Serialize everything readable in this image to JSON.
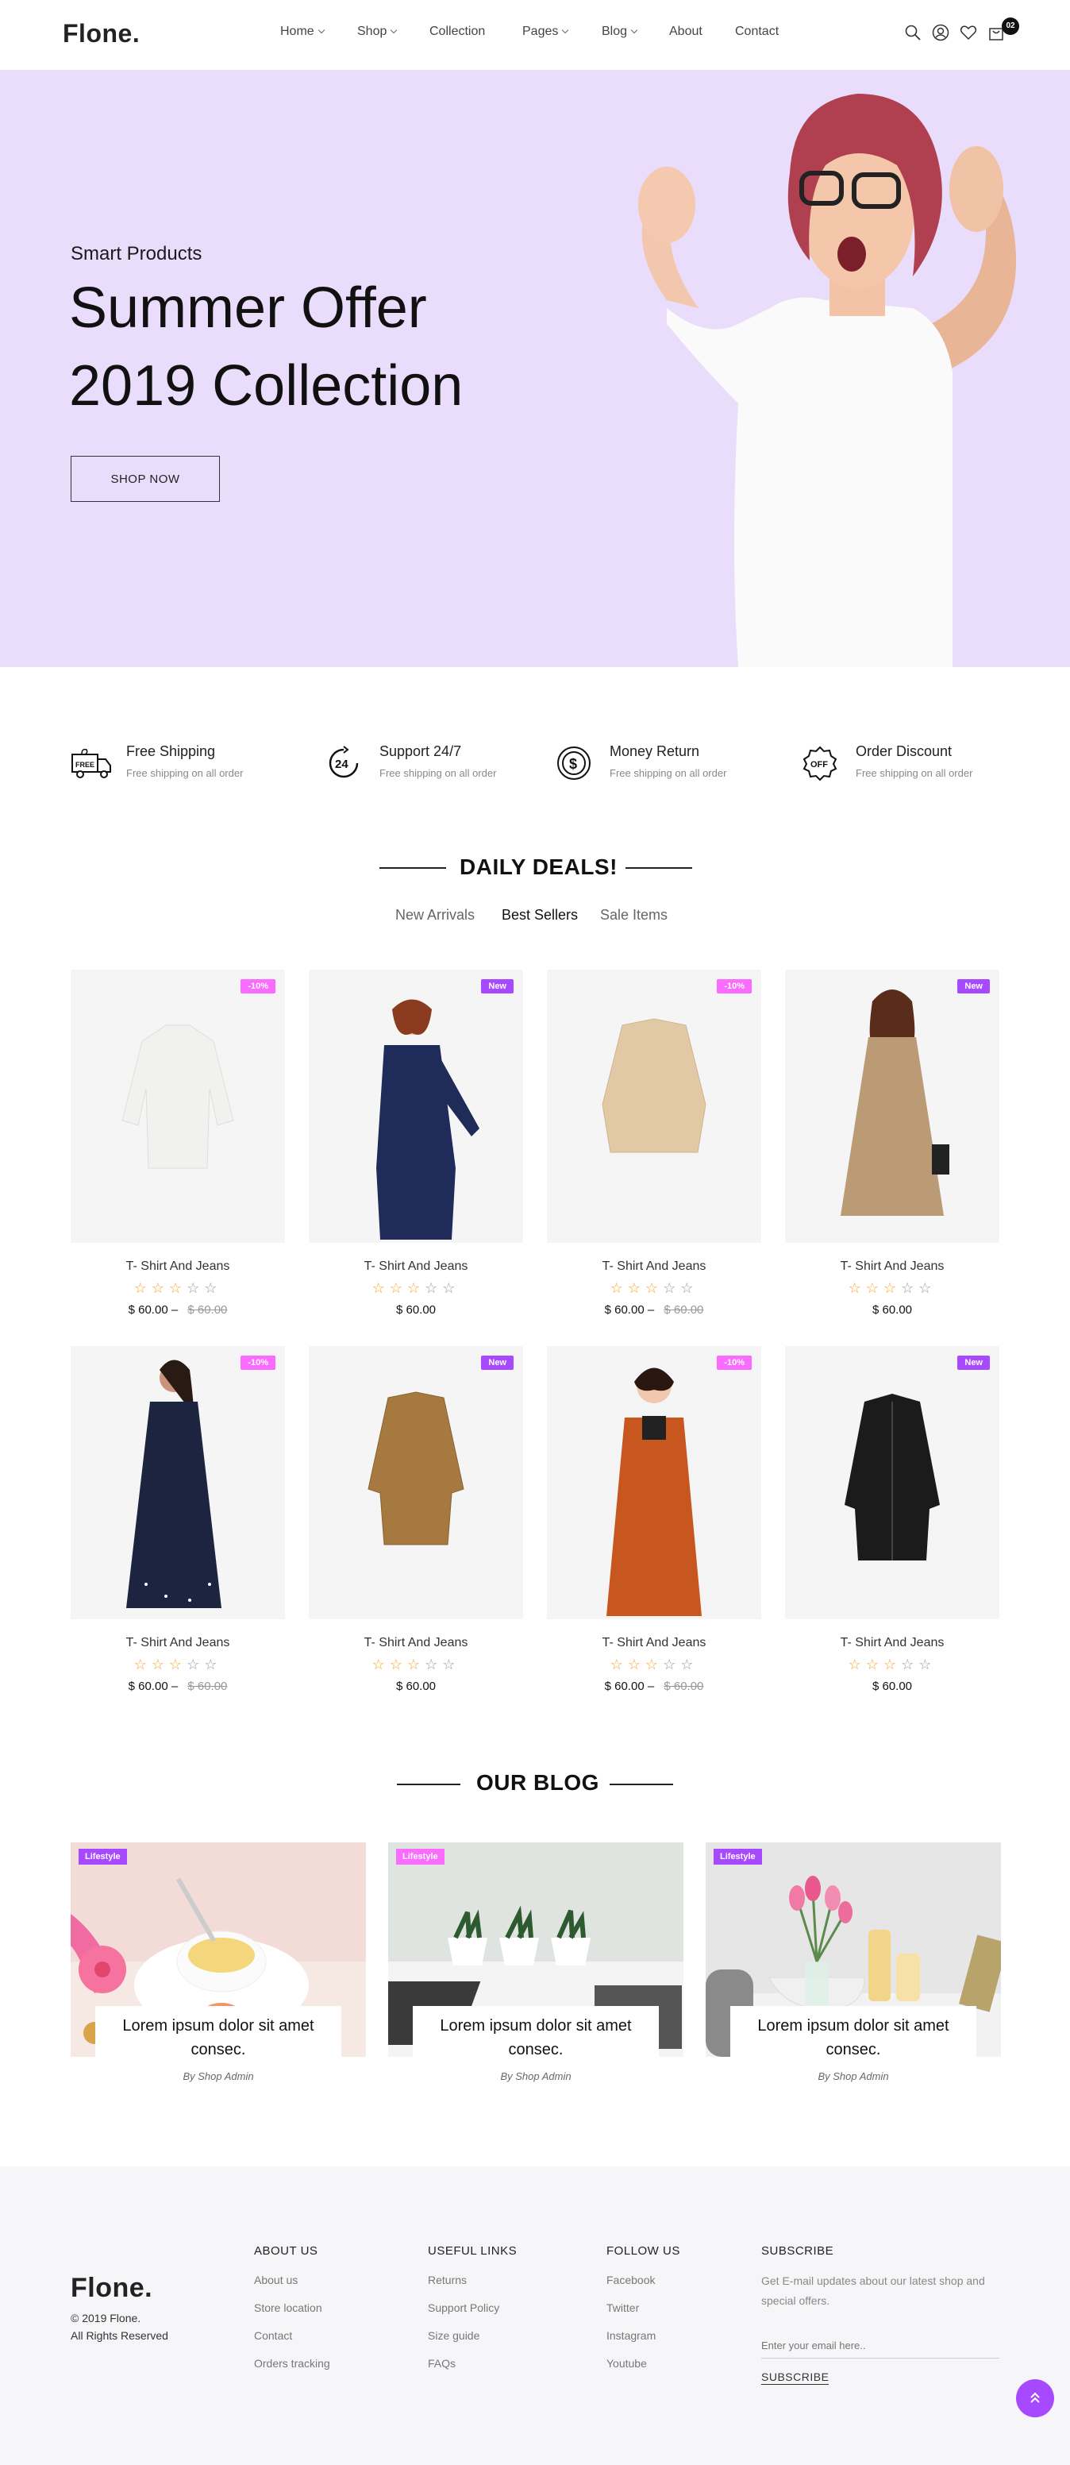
{
  "header": {
    "logo": "Flone.",
    "nav": [
      {
        "label": "Home",
        "dropdown": true
      },
      {
        "label": "Shop",
        "dropdown": true
      },
      {
        "label": "Collection",
        "dropdown": false
      },
      {
        "label": "Pages",
        "dropdown": true
      },
      {
        "label": "Blog",
        "dropdown": true
      },
      {
        "label": "About",
        "dropdown": false
      },
      {
        "label": "Contact",
        "dropdown": false
      }
    ],
    "icons": [
      "search-icon",
      "user-icon",
      "heart-icon",
      "cart-icon"
    ],
    "cart_count": "02"
  },
  "hero": {
    "kicker": "Smart Products",
    "title_line1": "Summer Offer",
    "title_line2": "2019 Collection",
    "button": "SHOP NOW",
    "bg_color": "#eadcfb"
  },
  "features": [
    {
      "icon": "free-shipping-truck-icon",
      "title": "Free Shipping",
      "subtitle": "Free shipping on all order"
    },
    {
      "icon": "support-24-icon",
      "title": "Support 24/7",
      "subtitle": "Free shipping on all order"
    },
    {
      "icon": "money-return-icon",
      "title": "Money Return",
      "subtitle": "Free shipping on all order"
    },
    {
      "icon": "order-discount-icon",
      "title": "Order Discount",
      "subtitle": "Free shipping on all order"
    }
  ],
  "deals": {
    "title": "DAILY DEALS!",
    "tabs": [
      {
        "label": "New Arrivals",
        "active": false
      },
      {
        "label": "Best Sellers",
        "active": true
      },
      {
        "label": "Sale Items",
        "active": false
      }
    ],
    "products": [
      {
        "tag": "-10%",
        "name": "T- Shirt And Jeans",
        "rating": 3,
        "price": "$ 60.00",
        "old_price": "$ 60.00"
      },
      {
        "tag": "New",
        "name": "T- Shirt And Jeans",
        "rating": 3,
        "price": "$ 60.00",
        "old_price": ""
      },
      {
        "tag": "-10%",
        "name": "T- Shirt And Jeans",
        "rating": 3,
        "price": "$ 60.00",
        "old_price": "$ 60.00"
      },
      {
        "tag": "New",
        "name": "T- Shirt And Jeans",
        "rating": 3,
        "price": "$ 60.00",
        "old_price": ""
      },
      {
        "tag": "-10%",
        "name": "T- Shirt And Jeans",
        "rating": 3,
        "price": "$ 60.00",
        "old_price": "$ 60.00"
      },
      {
        "tag": "New",
        "name": "T- Shirt And Jeans",
        "rating": 3,
        "price": "$ 60.00",
        "old_price": ""
      },
      {
        "tag": "-10%",
        "name": "T- Shirt And Jeans",
        "rating": 3,
        "price": "$ 60.00",
        "old_price": "$ 60.00"
      },
      {
        "tag": "New",
        "name": "T- Shirt And Jeans",
        "rating": 3,
        "price": "$ 60.00",
        "old_price": ""
      }
    ]
  },
  "blog": {
    "title": "OUR BLOG",
    "posts": [
      {
        "tag": "Lifestyle",
        "title": "Lorem ipsum dolor sit amet consec.",
        "by": "By Shop Admin"
      },
      {
        "tag": "Lifestyle",
        "title": "Lorem ipsum dolor sit amet consec.",
        "by": "By Shop Admin"
      },
      {
        "tag": "Lifestyle",
        "title": "Lorem ipsum dolor sit amet consec.",
        "by": "By Shop Admin"
      }
    ]
  },
  "footer": {
    "logo": "Flone.",
    "copyright": "© 2019 Flone.",
    "rights": "All Rights Reserved",
    "columns": [
      {
        "heading": "ABOUT US",
        "links": [
          "About us",
          "Store location",
          "Contact",
          "Orders tracking"
        ]
      },
      {
        "heading": "USEFUL LINKS",
        "links": [
          "Returns",
          "Support Policy",
          "Size guide",
          "FAQs"
        ]
      },
      {
        "heading": "FOLLOW US",
        "links": [
          "Facebook",
          "Twitter",
          "Instagram",
          "Youtube"
        ]
      }
    ],
    "subscribe": {
      "heading": "SUBSCRIBE",
      "text": "Get E-mail updates about our latest shop and special offers.",
      "placeholder": "Enter your email here..",
      "button": "SUBSCRIBE"
    }
  },
  "colors": {
    "accent": "#a749ff",
    "tag_discount": "#fa6bff",
    "tag_new": "#a749ff",
    "star": "#f5a623"
  }
}
